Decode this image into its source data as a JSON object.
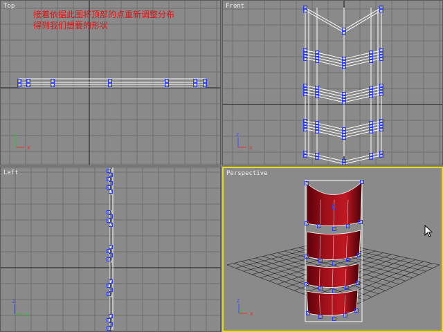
{
  "viewports": [
    {
      "key": "top",
      "label": "Top",
      "active": false
    },
    {
      "key": "front",
      "label": "Front",
      "active": false
    },
    {
      "key": "left",
      "label": "Left",
      "active": false
    },
    {
      "key": "perspective",
      "label": "Perspective",
      "active": true
    }
  ],
  "annotation": {
    "line1": "接着依据此图将顶部的点重新调整分布",
    "line2": "得到我们想要的形状"
  },
  "colors": {
    "grid_bg": "#8a8a8a",
    "grid_line": "#6e6e6e",
    "axis_line": "#1a1a1a",
    "wire": "#ffffff",
    "vertex": "#2a3cff",
    "active_border": "#e8e000",
    "annotation": "#e01010",
    "object_fill": "#a0101a",
    "gizmo_x": "#e03030",
    "gizmo_y": "#30c030",
    "gizmo_z": "#3050ff"
  },
  "gizmo_labels": {
    "x": "x",
    "y": "y",
    "z": "z"
  }
}
